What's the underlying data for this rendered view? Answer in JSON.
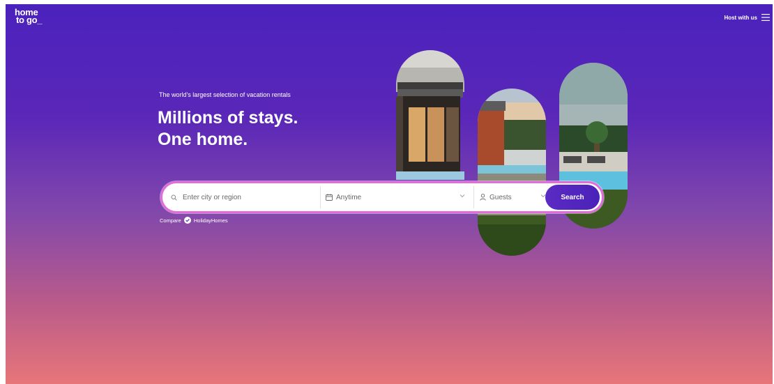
{
  "header": {
    "logo_line1": "home",
    "logo_line2": "to go_",
    "host_link": "Host with us",
    "menu_icon": "hamburger-menu-icon"
  },
  "hero": {
    "tagline": "The world's largest selection of vacation rentals",
    "headline_line1": "Millions of stays.",
    "headline_line2": "One home."
  },
  "search": {
    "city_placeholder": "Enter city or region",
    "city_icon": "search-icon",
    "date_label": "Anytime",
    "date_icon": "calendar-icon",
    "guests_label": "Guests",
    "guests_icon": "person-icon",
    "button_label": "Search",
    "accent_color": "#e26cdb",
    "button_color": "#4a22b8"
  },
  "compare": {
    "prefix": "Compare",
    "partner": "HolidayHomes",
    "icon": "check-circle-icon"
  },
  "colors": {
    "bg_top": "#4b22bd",
    "bg_bottom": "#e77679"
  }
}
